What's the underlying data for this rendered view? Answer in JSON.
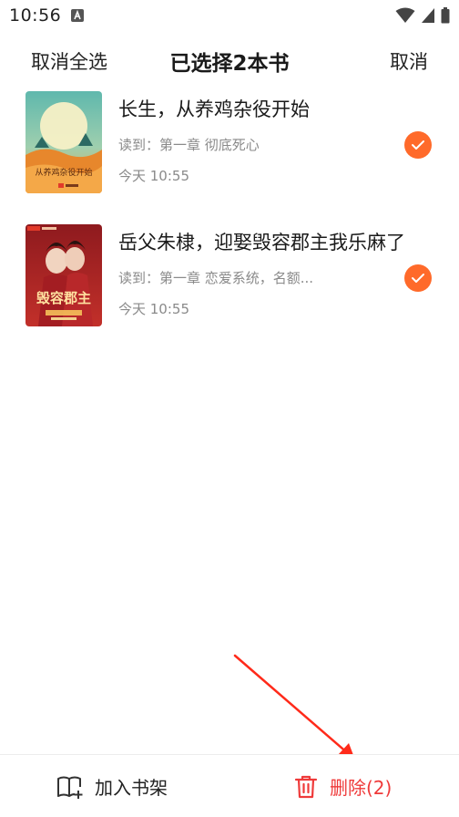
{
  "status_bar": {
    "time": "10:56"
  },
  "header": {
    "left_label": "取消全选",
    "title": "已选择2本书",
    "right_label": "取消"
  },
  "books": [
    {
      "title": "长生，从养鸡杂役开始",
      "progress": "读到：第一章 彻底死心",
      "time": "今天 10:55",
      "selected": true,
      "cover_text": "从养鸡杂役开始"
    },
    {
      "title": "岳父朱棣，迎娶毁容郡主我乐麻了",
      "progress": "读到：第一章 恋爱系统，名额...",
      "time": "今天 10:55",
      "selected": true,
      "cover_text": "毁容郡主"
    }
  ],
  "bottom": {
    "add_label": "加入书架",
    "delete_label": "删除(2)"
  },
  "colors": {
    "accent": "#ff6a2a",
    "delete": "#ef3a3a",
    "arrow": "#ff2a1a"
  }
}
